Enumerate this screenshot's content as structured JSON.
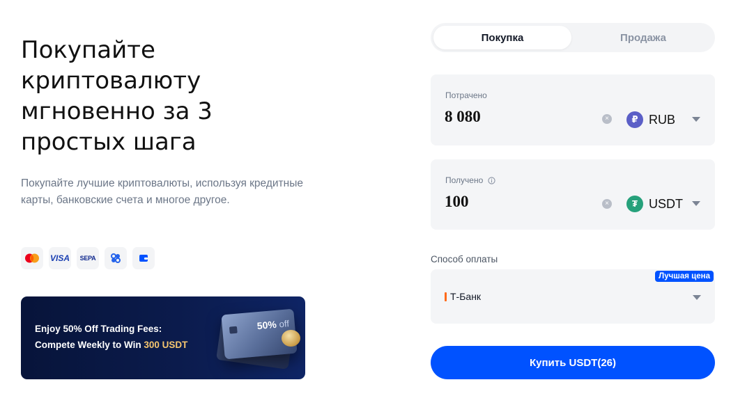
{
  "hero": {
    "title": "Покупайте криптовалюту мгновенно за 3 простых шага",
    "subtitle": "Покупайте лучшие криптовалюты, используя кредитные карты, банковские счета и многое другое."
  },
  "payment_icons": [
    {
      "icon": "mastercard-icon"
    },
    {
      "icon": "visa-icon",
      "text": "VISA"
    },
    {
      "icon": "sepa-icon",
      "text": "SEPA"
    },
    {
      "icon": "apple-pay-icon"
    },
    {
      "icon": "wallet-icon"
    }
  ],
  "banner": {
    "line1": "Enjoy 50% Off Trading Fees:",
    "line2_prefix": "Compete Weekly to Win ",
    "line2_highlight": "300 USDT",
    "card_badge": "50%",
    "card_badge_suffix": "off"
  },
  "trade_tabs": [
    {
      "label": "Покупка",
      "active": true
    },
    {
      "label": "Продажа",
      "active": false
    }
  ],
  "spend": {
    "label": "Потрачено",
    "value": "8 080",
    "currency": "RUB",
    "currency_symbol": "₽",
    "currency_color": "#5b5fc7"
  },
  "receive": {
    "label": "Получено",
    "value": "100",
    "currency": "USDT",
    "currency_symbol": "₮",
    "currency_color": "#26a17b"
  },
  "payment_method": {
    "label": "Способ оплаты",
    "value": "Т-Банк",
    "badge": "Лучшая цена"
  },
  "buy_button": {
    "label": "Купить USDT(26)"
  },
  "colors": {
    "accent": "#0052ff",
    "field_bg": "#f4f5f7"
  }
}
